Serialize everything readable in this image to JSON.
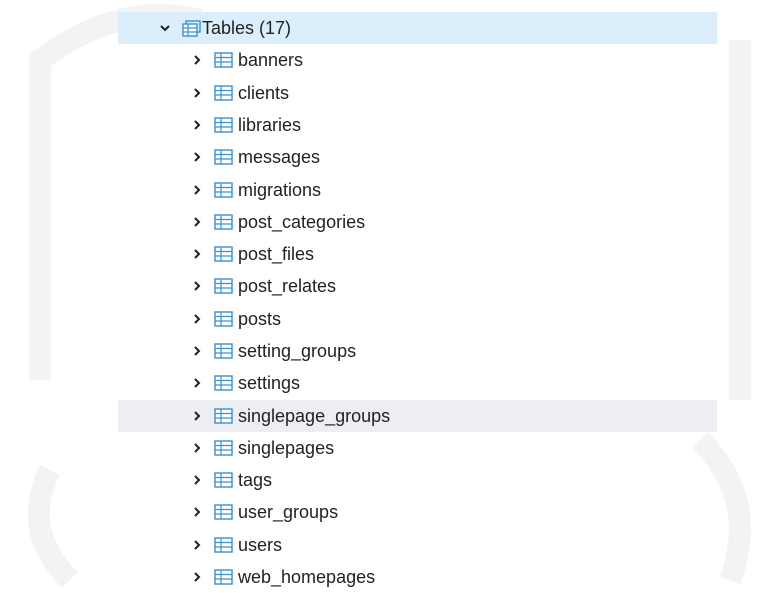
{
  "tree": {
    "root_label": "Tables (17)",
    "items": [
      {
        "label": "banners"
      },
      {
        "label": "clients"
      },
      {
        "label": "libraries"
      },
      {
        "label": "messages"
      },
      {
        "label": "migrations"
      },
      {
        "label": "post_categories"
      },
      {
        "label": "post_files"
      },
      {
        "label": "post_relates"
      },
      {
        "label": "posts"
      },
      {
        "label": "setting_groups"
      },
      {
        "label": "settings"
      },
      {
        "label": "singlepage_groups"
      },
      {
        "label": "singlepages"
      },
      {
        "label": "tags"
      },
      {
        "label": "user_groups"
      },
      {
        "label": "users"
      },
      {
        "label": "web_homepages"
      }
    ]
  },
  "colors": {
    "root_highlight": "#dbeefb",
    "hover_highlight": "#eceef2",
    "icon_blue": "#3a8fd6"
  }
}
